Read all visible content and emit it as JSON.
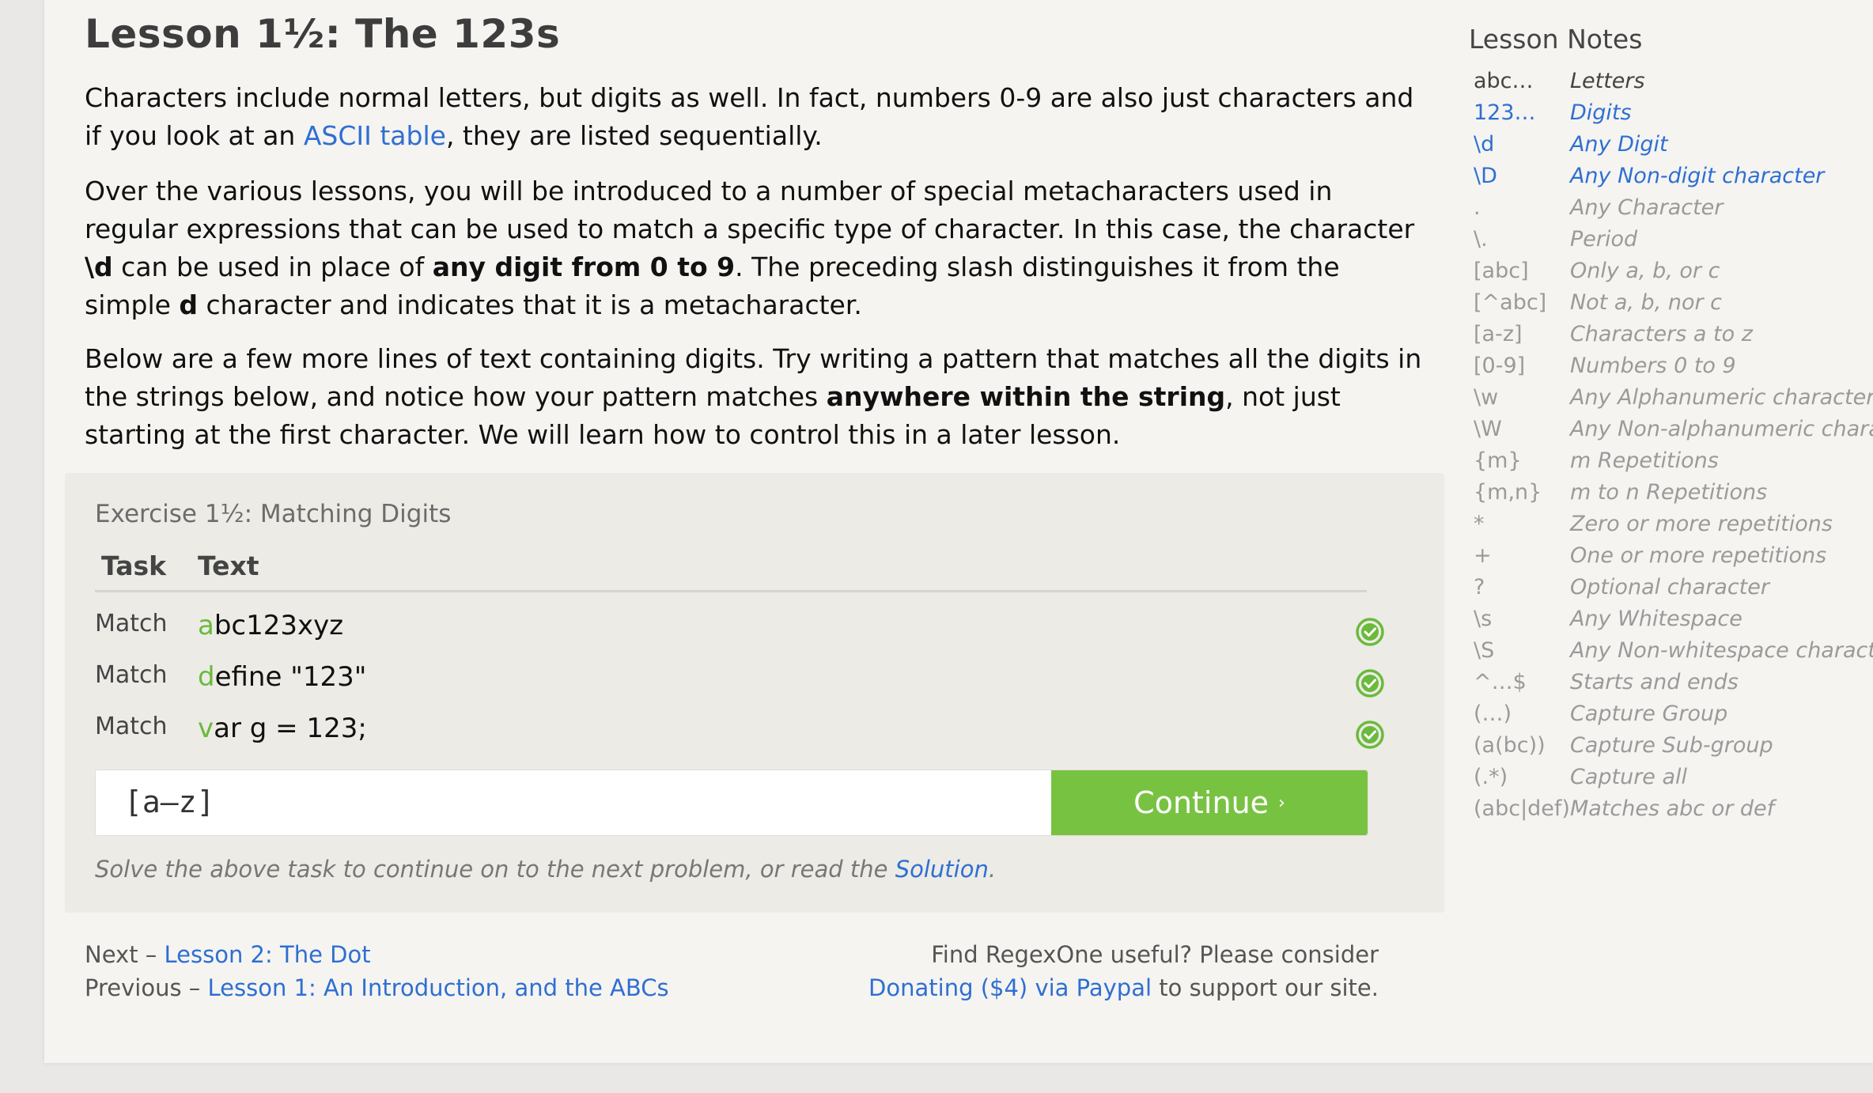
{
  "lesson": {
    "title": "Lesson 1½: The 123s",
    "para1": {
      "t1": "Characters include normal letters, but digits as well. In fact, numbers 0-9 are also just characters and if you look at an ",
      "link": "ASCII table",
      "t2": ", they are listed sequentially."
    },
    "para2": {
      "t1": "Over the various lessons, you will be introduced to a number of special metacharacters used in regular expressions that can be used to match a specific type of character. In this case, the character ",
      "b1": "\\d",
      "t2": " can be used in place of ",
      "b2": "any digit from 0 to 9",
      "t3": ". The preceding slash distinguishes it from the simple ",
      "b3": "d",
      "t4": " character and indicates that it is a metacharacter."
    },
    "para3": {
      "t1": "Below are a few more lines of text containing digits. Try writing a pattern that matches all the digits in the strings below, and notice how your pattern matches ",
      "b1": "anywhere within the string",
      "t2": ", not just starting at the first character. We will learn how to control this in a later lesson."
    }
  },
  "exercise": {
    "title": "Exercise 1½: Matching Digits",
    "col_task": "Task",
    "col_text": "Text",
    "rows": [
      {
        "task": "Match",
        "highlight": "a",
        "rest": "bc123xyz",
        "status": "check-circle-icon"
      },
      {
        "task": "Match",
        "highlight": "d",
        "rest": "efine \"123\"",
        "status": "check-circle-icon"
      },
      {
        "task": "Match",
        "highlight": "v",
        "rest": "ar g = 123;",
        "status": "check-circle-icon"
      }
    ],
    "input_value": "[a–z]",
    "continue_label": "Continue",
    "continue_chevron": "›",
    "footer_text": "Solve the above task to continue on to the next problem, or read the ",
    "footer_link": "Solution",
    "footer_end": "."
  },
  "nav": {
    "next_prefix": "Next – ",
    "next_link": "Lesson 2: The Dot",
    "prev_prefix": "Previous – ",
    "prev_link": "Lesson 1: An Introduction, and the ABCs"
  },
  "donate": {
    "line1": "Find RegexOne useful? Please consider",
    "link": "Donating ($4) via Paypal",
    "line2": " to support our site."
  },
  "notes": {
    "title": "Lesson Notes",
    "items": [
      {
        "k": "abc…",
        "v": "Letters",
        "state": "done"
      },
      {
        "k": "123…",
        "v": "Digits",
        "state": "active"
      },
      {
        "k": "\\d",
        "v": "Any Digit",
        "state": "active"
      },
      {
        "k": "\\D",
        "v": "Any Non-digit character",
        "state": "active"
      },
      {
        "k": ".",
        "v": "Any Character",
        "state": ""
      },
      {
        "k": "\\.",
        "v": "Period",
        "state": ""
      },
      {
        "k": "[abc]",
        "v": "Only a, b, or c",
        "state": ""
      },
      {
        "k": "[^abc]",
        "v": "Not a, b, nor c",
        "state": ""
      },
      {
        "k": "[a-z]",
        "v": "Characters a to z",
        "state": ""
      },
      {
        "k": "[0-9]",
        "v": "Numbers 0 to 9",
        "state": ""
      },
      {
        "k": "\\w",
        "v": "Any Alphanumeric character",
        "state": ""
      },
      {
        "k": "\\W",
        "v": "Any Non-alphanumeric character",
        "state": ""
      },
      {
        "k": "{m}",
        "v": "m Repetitions",
        "state": ""
      },
      {
        "k": "{m,n}",
        "v": "m to n Repetitions",
        "state": ""
      },
      {
        "k": "*",
        "v": "Zero or more repetitions",
        "state": ""
      },
      {
        "k": "+",
        "v": "One or more repetitions",
        "state": ""
      },
      {
        "k": "?",
        "v": "Optional character",
        "state": ""
      },
      {
        "k": "\\s",
        "v": "Any Whitespace",
        "state": ""
      },
      {
        "k": "\\S",
        "v": "Any Non-whitespace character",
        "state": ""
      },
      {
        "k": "^…$",
        "v": "Starts and ends",
        "state": ""
      },
      {
        "k": "(…)",
        "v": "Capture Group",
        "state": ""
      },
      {
        "k": "(a(bc))",
        "v": "Capture Sub-group",
        "state": ""
      },
      {
        "k": "(.*)",
        "v": "Capture all",
        "state": ""
      },
      {
        "k": "(abc|def)",
        "v": "Matches abc or def",
        "state": ""
      }
    ]
  },
  "colors": {
    "accent_green": "#78c242",
    "link_blue": "#2f6fd1",
    "highlight_green": "#6aba3c"
  }
}
